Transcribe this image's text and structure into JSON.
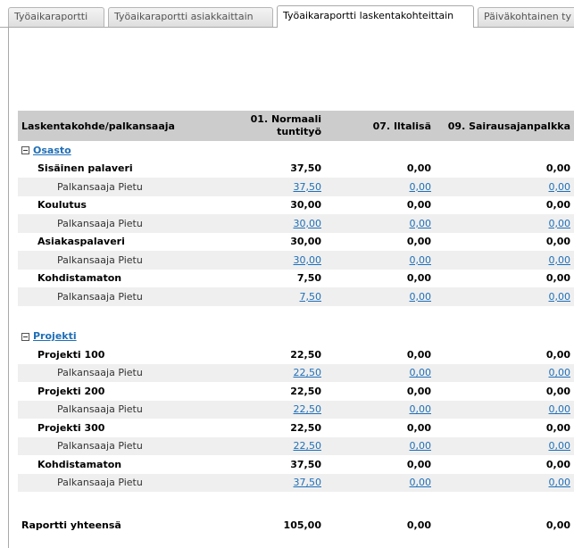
{
  "tabs": [
    {
      "label": "Työaikaraportti",
      "active": false
    },
    {
      "label": "Työaikaraportti asiakkaittain",
      "active": false
    },
    {
      "label": "Työaikaraportti laskentakohteittain",
      "active": true
    },
    {
      "label": "Päiväkohtainen ty",
      "active": false
    }
  ],
  "table": {
    "headers": {
      "col1": "Laskentakohde/palkansaaja",
      "col2": "01. Normaali tuntityö",
      "col3": "07. Iltalisä",
      "col4": "09. Sairausajanpalkka"
    },
    "groups": [
      {
        "name": "Osasto",
        "items": [
          {
            "name": "Sisäinen palaveri",
            "values": [
              "37,50",
              "0,00",
              "0,00"
            ],
            "person": {
              "name": "Palkansaaja Pietu",
              "values": [
                "37,50",
                "0,00",
                "0,00"
              ]
            }
          },
          {
            "name": "Koulutus",
            "values": [
              "30,00",
              "0,00",
              "0,00"
            ],
            "person": {
              "name": "Palkansaaja Pietu",
              "values": [
                "30,00",
                "0,00",
                "0,00"
              ]
            }
          },
          {
            "name": "Asiakaspalaveri",
            "values": [
              "30,00",
              "0,00",
              "0,00"
            ],
            "person": {
              "name": "Palkansaaja Pietu",
              "values": [
                "30,00",
                "0,00",
                "0,00"
              ]
            }
          },
          {
            "name": "Kohdistamaton",
            "values": [
              "7,50",
              "0,00",
              "0,00"
            ],
            "person": {
              "name": "Palkansaaja Pietu",
              "values": [
                "7,50",
                "0,00",
                "0,00"
              ]
            }
          }
        ]
      },
      {
        "name": "Projekti",
        "items": [
          {
            "name": "Projekti 100",
            "values": [
              "22,50",
              "0,00",
              "0,00"
            ],
            "person": {
              "name": "Palkansaaja Pietu",
              "values": [
                "22,50",
                "0,00",
                "0,00"
              ]
            }
          },
          {
            "name": "Projekti 200",
            "values": [
              "22,50",
              "0,00",
              "0,00"
            ],
            "person": {
              "name": "Palkansaaja Pietu",
              "values": [
                "22,50",
                "0,00",
                "0,00"
              ]
            }
          },
          {
            "name": "Projekti 300",
            "values": [
              "22,50",
              "0,00",
              "0,00"
            ],
            "person": {
              "name": "Palkansaaja Pietu",
              "values": [
                "22,50",
                "0,00",
                "0,00"
              ]
            }
          },
          {
            "name": "Kohdistamaton",
            "values": [
              "37,50",
              "0,00",
              "0,00"
            ],
            "person": {
              "name": "Palkansaaja Pietu",
              "values": [
                "37,50",
                "0,00",
                "0,00"
              ]
            }
          }
        ]
      }
    ],
    "total": {
      "label": "Raportti yhteensä",
      "values": [
        "105,00",
        "0,00",
        "0,00"
      ]
    }
  }
}
